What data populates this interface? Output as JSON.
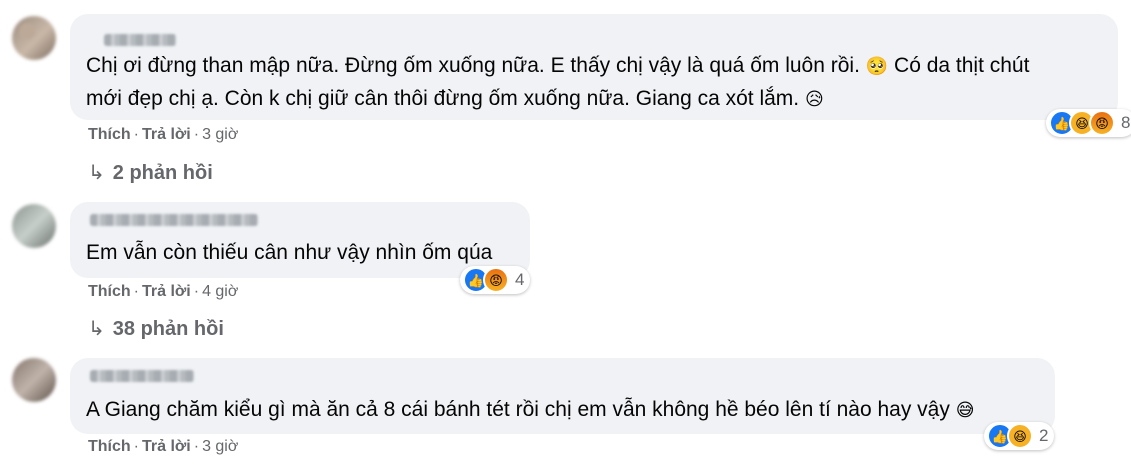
{
  "comments": [
    {
      "text_lines": [
        "Chị ơi đừng than mập nữa. Đừng ốm xuống nữa. E thấy chị vậy là quá ốm luôn rồi.",
        "mới đẹp chị ạ. Còn k chị giữ cân thôi đừng ốm xuống nữa. Giang ca xót lắm."
      ],
      "inline_tail_1": "Có da thịt chút",
      "emoji_1": "🥺",
      "emoji_2": "😥",
      "like_label": "Thích",
      "reply_label": "Trả lời",
      "time": "3 giờ",
      "reaction_count": "8",
      "replies_label": "2 phản hồi"
    },
    {
      "text_lines": [
        "Em vẫn còn thiếu cân như vậy nhìn ốm qúa"
      ],
      "like_label": "Thích",
      "reply_label": "Trả lời",
      "time": "4 giờ",
      "reaction_count": "4",
      "replies_label": "38 phản hồi"
    },
    {
      "text_lines": [
        "A Giang chăm kiểu gì mà ăn cả 8 cái bánh tét rồi chị em vẫn không hề béo lên tí nào hay vậy"
      ],
      "emoji_1": "😅",
      "like_label": "Thích",
      "reply_label": "Trả lời",
      "time": "3 giờ",
      "reaction_count": "2"
    }
  ],
  "icons": {
    "replies_arrow": "↳",
    "like": "👍",
    "haha": "😆",
    "angry": "😡"
  },
  "colors": {
    "bubble": "#f0f2f5",
    "meta": "#65676b",
    "like_blue": "#1877f2"
  }
}
